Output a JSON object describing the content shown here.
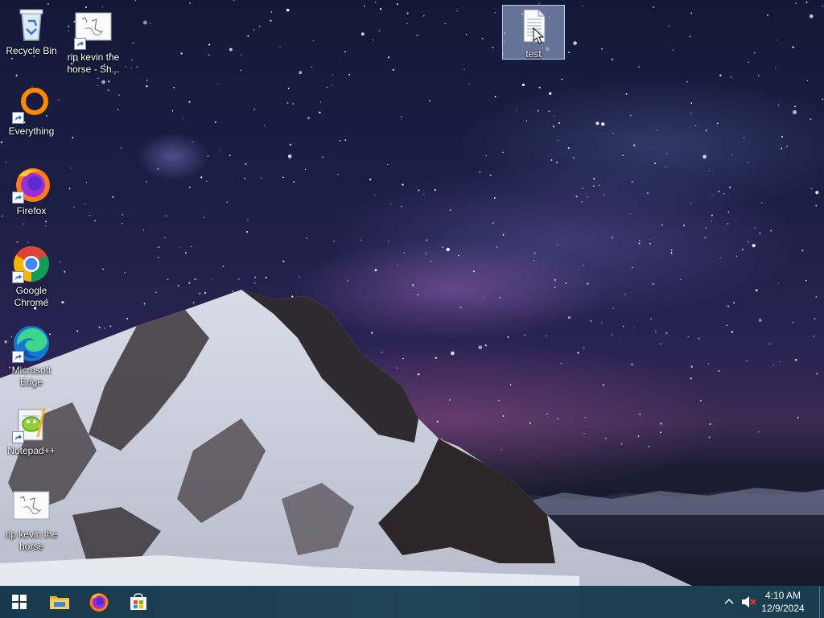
{
  "desktop": {
    "icons": [
      {
        "label": "Recycle Bin",
        "icon": "recycle-bin-icon"
      },
      {
        "label": "rip kevin the horse - Sh...",
        "icon": "image-shortcut-icon"
      },
      {
        "label": "test",
        "icon": "text-file-icon",
        "selected": true
      },
      {
        "label": "Everything",
        "icon": "everything-icon"
      },
      {
        "label": "Firefox",
        "icon": "firefox-icon"
      },
      {
        "label": "Google Chrome",
        "icon": "chrome-icon"
      },
      {
        "label": "Microsoft Edge",
        "icon": "edge-icon"
      },
      {
        "label": "Notepad++",
        "icon": "notepadpp-icon"
      },
      {
        "label": "rip kevin the horse",
        "icon": "image-file-icon"
      }
    ]
  },
  "taskbar": {
    "pinned": [
      {
        "name": "start",
        "icon": "windows-logo-icon"
      },
      {
        "name": "file-explorer",
        "icon": "folder-icon"
      },
      {
        "name": "firefox",
        "icon": "firefox-icon"
      },
      {
        "name": "microsoft-store",
        "icon": "store-icon"
      }
    ],
    "tray": {
      "overflow_icon": "chevron-up-icon",
      "volume_icon": "volume-muted-icon"
    },
    "clock": {
      "time": "4:10 AM",
      "date": "12/9/2024"
    }
  },
  "colors": {
    "taskbar": "#1f4558",
    "selection": "#aabee6"
  }
}
